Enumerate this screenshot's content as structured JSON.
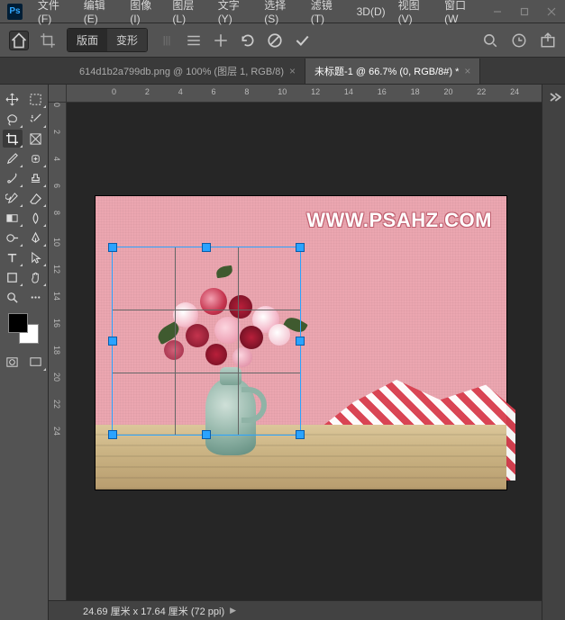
{
  "app": {
    "name": "Ps"
  },
  "menu": {
    "file": "文件(F)",
    "edit": "编辑(E)",
    "image": "图像(I)",
    "layer": "图层(L)",
    "type": "文字(Y)",
    "select": "选择(S)",
    "filter": "滤镜(T)",
    "threeD": "3D(D)",
    "view": "视图(V)",
    "window": "窗口(W"
  },
  "options": {
    "seg1": "版面",
    "seg2": "变形"
  },
  "tabs": {
    "t1": {
      "label": "614d1b2a799db.png @ 100% (图层 1, RGB/8)",
      "active": false
    },
    "t2": {
      "label": "未标题-1 @ 66.7% (0, RGB/8#) *",
      "active": true
    }
  },
  "ruler": {
    "h": [
      "0",
      "2",
      "4",
      "6",
      "8",
      "10",
      "12",
      "14",
      "16",
      "18",
      "20",
      "22",
      "24"
    ],
    "v": [
      "0",
      "2",
      "4",
      "6",
      "8",
      "10",
      "12",
      "14",
      "16",
      "18",
      "20",
      "22",
      "24"
    ]
  },
  "document": {
    "watermark": "WWW.PSAHZ.COM",
    "background_color": "#eba6b0",
    "transform_color": "#2aa3ff"
  },
  "status": {
    "text": "24.69 厘米 x 17.64 厘米 (72 ppi)"
  },
  "swatches": {
    "fg": "#000000",
    "bg": "#ffffff"
  }
}
